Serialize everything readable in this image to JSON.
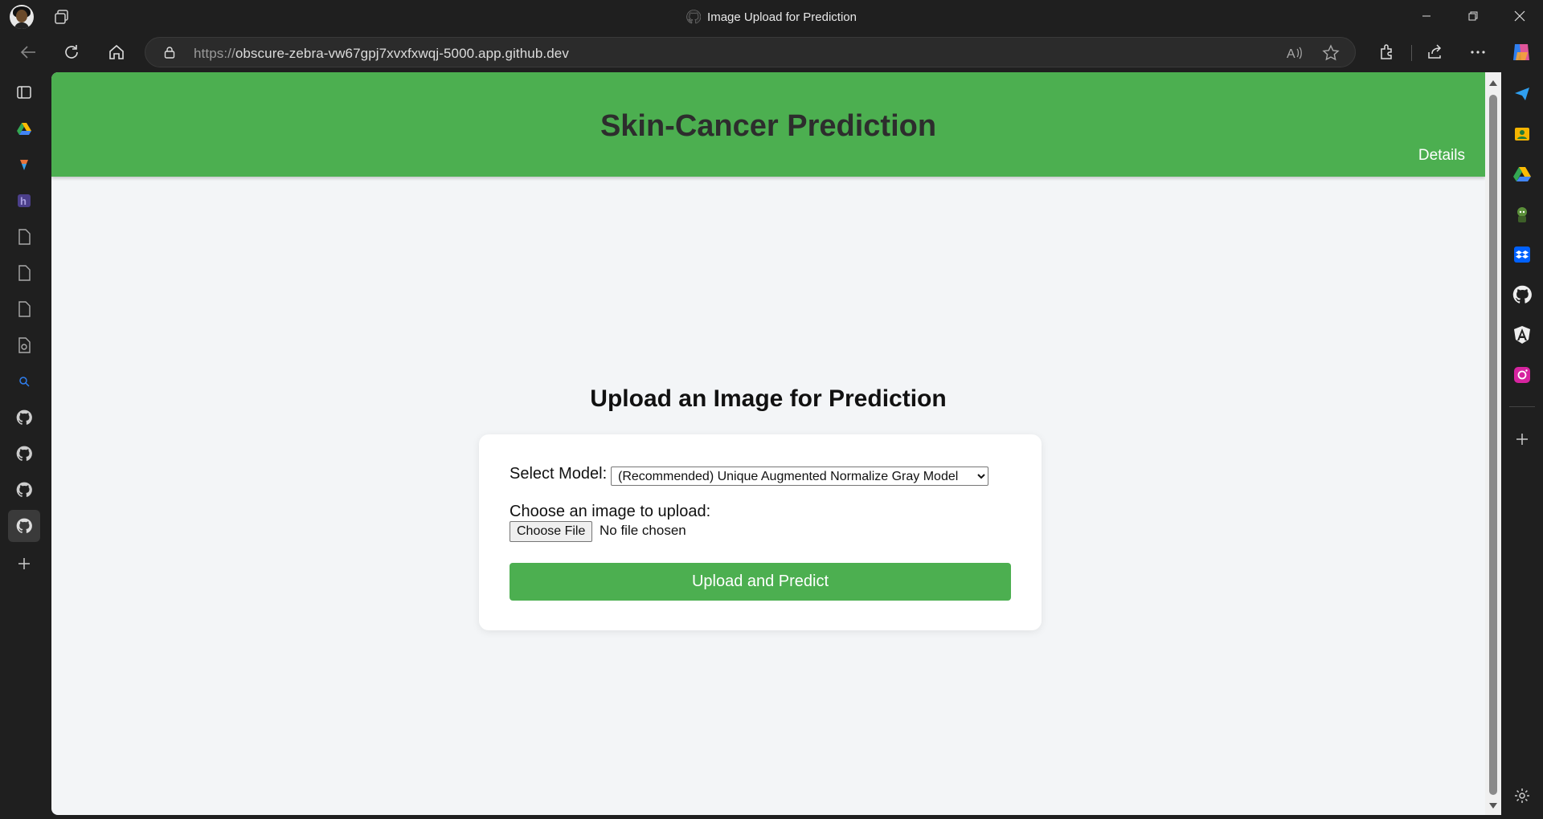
{
  "browser": {
    "window_title": "Image Upload for Prediction",
    "url_protocol": "https://",
    "url_host": "obscure-zebra-vw67gpj7xvxfxwqj-5000.app.github.dev"
  },
  "header": {
    "title": "Skin-Cancer Prediction",
    "details_link": "Details",
    "color": "#4caf50"
  },
  "main": {
    "heading": "Upload an Image for Prediction",
    "model_label": "Select Model:",
    "model_selected": "(Recommended) Unique Augmented Normalize Gray Model",
    "file_label": "Choose an image to upload:",
    "file_button": "Choose File",
    "file_status": "No file chosen",
    "submit_label": "Upload and Predict"
  },
  "left_sidebar_icons": [
    "sidebar-panel-icon",
    "google-drive-icon",
    "colorful-app-icon",
    "hashnode-icon",
    "page-icon",
    "page-icon",
    "page-icon",
    "page-gear-icon",
    "search-icon",
    "github-icon",
    "github-icon",
    "github-icon",
    "github-icon",
    "add-icon"
  ],
  "right_sidebar_icons": [
    "send-icon",
    "contacts-icon",
    "google-drive-icon",
    "game-icon",
    "dropbox-icon",
    "github-icon",
    "angular-icon",
    "instagram-icon",
    "add-icon",
    "settings-icon"
  ]
}
